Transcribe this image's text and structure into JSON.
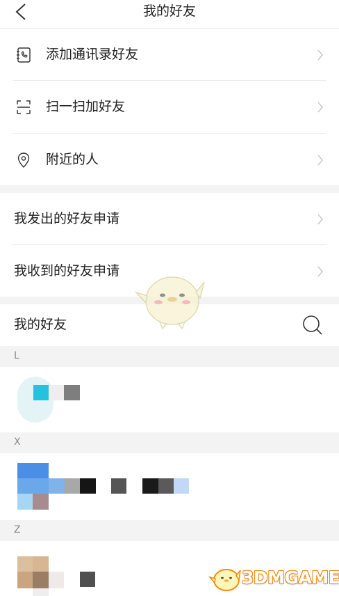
{
  "header": {
    "title": "我的好友",
    "back_icon": "chevron-left-icon"
  },
  "menu": [
    {
      "label": "添加通讯录好友",
      "icon": "phone-book-icon"
    },
    {
      "label": "扫一扫加好友",
      "icon": "scan-icon"
    },
    {
      "label": "附近的人",
      "icon": "location-pin-icon"
    }
  ],
  "requests": [
    {
      "label": "我发出的好友申请"
    },
    {
      "label": "我收到的好友申请"
    }
  ],
  "friends": {
    "title": "我的好友",
    "search_icon": "search-icon",
    "sections": [
      "L",
      "X",
      "Z"
    ]
  },
  "watermark": {
    "text": "3DMGAME"
  },
  "colors": {
    "divider": "#ececec",
    "section_bg": "#f3f3f3",
    "chevron": "#c8c8c8",
    "watermark": "#f08a12"
  }
}
